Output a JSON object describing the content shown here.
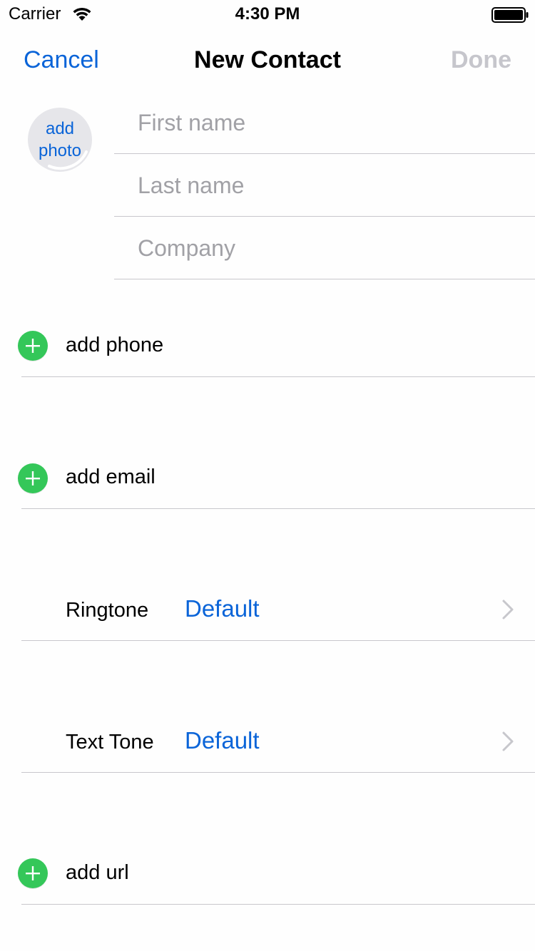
{
  "status_bar": {
    "carrier": "Carrier",
    "time": "4:30 PM"
  },
  "nav": {
    "cancel_label": "Cancel",
    "title": "New Contact",
    "done_label": "Done"
  },
  "photo": {
    "line1": "add",
    "line2": "photo"
  },
  "name_fields": {
    "first_name_placeholder": "First name",
    "last_name_placeholder": "Last name",
    "company_placeholder": "Company"
  },
  "rows": {
    "add_phone": "add phone",
    "add_email": "add email",
    "ringtone_label": "Ringtone",
    "ringtone_value": "Default",
    "text_tone_label": "Text Tone",
    "text_tone_value": "Default",
    "add_url": "add url"
  },
  "colors": {
    "accent_blue": "#0a64d8",
    "add_green": "#34c759",
    "disabled_gray": "#c6c6cc",
    "placeholder_gray": "#a1a1a6",
    "separator": "#c8c7cc"
  },
  "icons": {
    "wifi": "wifi-icon",
    "battery": "battery-icon",
    "add": "plus-circle-icon",
    "chevron": "chevron-right-icon"
  }
}
